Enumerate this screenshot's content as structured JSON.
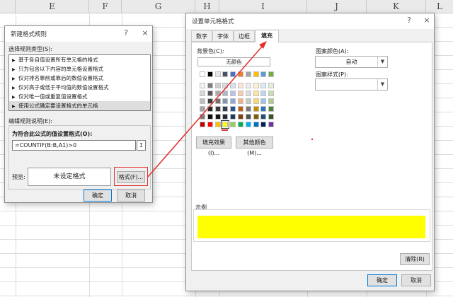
{
  "sheet": {
    "columns": [
      "E",
      "F",
      "G",
      "H",
      "I",
      "J",
      "K",
      "L"
    ]
  },
  "new_rule_dialog": {
    "title": "新建格式规则",
    "help": "?",
    "close": "×",
    "select_type_label": "选择规则类型(S):",
    "rule_types": [
      "基于各自值设置所有单元格的格式",
      "只为包含以下内容的单元格设置格式",
      "仅对排名靠前或靠后的数值设置格式",
      "仅对高于或低于平均值的数值设置格式",
      "仅对唯一值或重复值设置格式",
      "使用公式确定要设置格式的单元格"
    ],
    "selected_rule_index": 5,
    "edit_desc_label": "编辑规则说明(E):",
    "formula_label": "为符合此公式的值设置格式(O):",
    "formula_value": "=COUNTIF(B:B,A1)>0",
    "ref_button": "↥",
    "preview_label": "预览:",
    "preview_text": "未设定格式",
    "format_button": "格式(F)...",
    "ok_button": "确定",
    "cancel_button": "取消"
  },
  "format_cells_dialog": {
    "title": "设置单元格格式",
    "help": "?",
    "close": "×",
    "tabs": [
      "数字",
      "字体",
      "边框",
      "填充"
    ],
    "active_tab": "填充",
    "bg_color_label": "背景色(C):",
    "no_color_button": "无颜色",
    "pattern_color_label": "图案颜色(A):",
    "pattern_color_value": "自动",
    "pattern_style_label": "图案样式(P):",
    "pattern_style_value": "",
    "fill_effects_button": "填充效果(I)...",
    "more_colors_button": "其他颜色(M)...",
    "sample_label": "示例",
    "sample_color": "#ffff00",
    "clear_button": "清除(R)",
    "ok_button": "确定",
    "cancel_button": "取消",
    "selected_color": "#ffff00"
  },
  "annotation": {
    "color": "#e0312f"
  }
}
